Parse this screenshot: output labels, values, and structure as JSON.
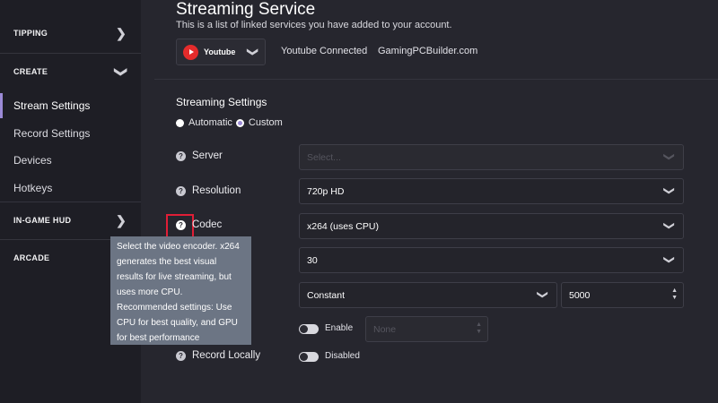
{
  "sidebar": {
    "sections": [
      {
        "label": "TIPPING",
        "chevron": "chevron-right"
      },
      {
        "label": "CREATE",
        "chevron": "chevron-down"
      },
      {
        "label": "IN-GAME HUD",
        "chevron": "chevron-right"
      },
      {
        "label": "ARCADE"
      }
    ],
    "create_items": [
      "Stream Settings",
      "Record Settings",
      "Devices",
      "Hotkeys"
    ],
    "active_item": "Stream Settings"
  },
  "streaming_service": {
    "title": "Streaming Service",
    "subtitle": "This is a list of linked services you have added to your account.",
    "service_select": "Youtube",
    "connection_status": "Youtube Connected",
    "account": "GamingPCBuilder.com"
  },
  "streaming_settings": {
    "title": "Streaming Settings",
    "mode_options": [
      "Automatic",
      "Custom"
    ],
    "selected_mode": "Custom",
    "server": {
      "label": "Server",
      "placeholder": "Select..."
    },
    "resolution": {
      "label": "Resolution",
      "value": "720p HD"
    },
    "codec": {
      "label": "Codec",
      "value": "x264 (uses CPU)"
    },
    "fps_value": "30",
    "bitrate_mode": "Constant",
    "bitrate_value": "5000",
    "extra_toggle": {
      "label": "Enable",
      "on": false,
      "input_placeholder": "None"
    },
    "record_locally": {
      "label": "Record Locally",
      "toggle_label": "Disabled",
      "on": false
    }
  },
  "tooltip": {
    "lines": [
      "Select the video encoder. x264",
      "generates the best visual",
      "results for live streaming, but",
      "uses more CPU.",
      "Recommended settings: Use",
      "CPU for best quality, and GPU",
      "for best performance"
    ]
  },
  "colors": {
    "accent": "#9b8ad6",
    "youtube_red": "#e42b2b",
    "highlight_box": "#e01e36",
    "tooltip_bg": "#6c7584"
  }
}
